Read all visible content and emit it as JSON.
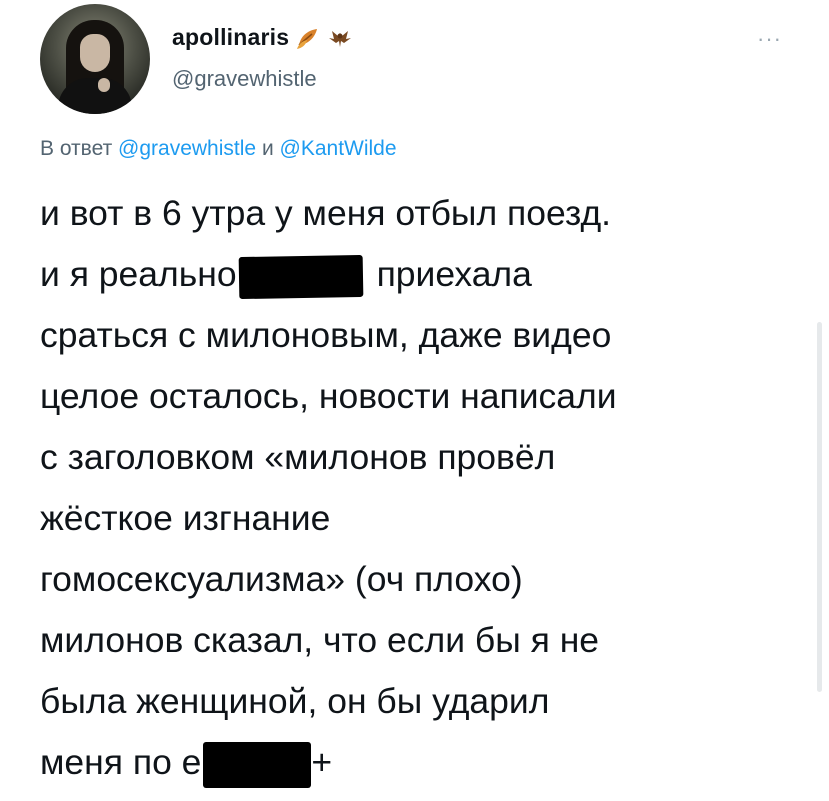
{
  "author": {
    "display_name": "apollinaris",
    "handle": "@gravewhistle",
    "name_emojis": [
      "autumn-leaf-icon",
      "bat-icon"
    ]
  },
  "more_menu": {
    "label": "···"
  },
  "reply": {
    "prefix": "В ответ",
    "mention_1": "@gravewhistle",
    "conjunction": "и",
    "mention_2": "@KantWilde"
  },
  "tweet": {
    "lines": [
      "и вот в 6 утра у меня отбыл поезд.",
      "и я реально",
      "приехала",
      "сраться с милоновым, даже видео",
      "целое осталось, новости написали",
      "с заголовком «милонов провёл",
      "жёсткое изгнание",
      "гомосексуализма» (оч плохо)",
      "милонов сказал, что если бы я не",
      "была женщиной, он бы ударил",
      "меня по е",
      "+"
    ]
  },
  "colors": {
    "text": "#0f1419",
    "secondary": "#536471",
    "link": "#1d9bf0"
  }
}
